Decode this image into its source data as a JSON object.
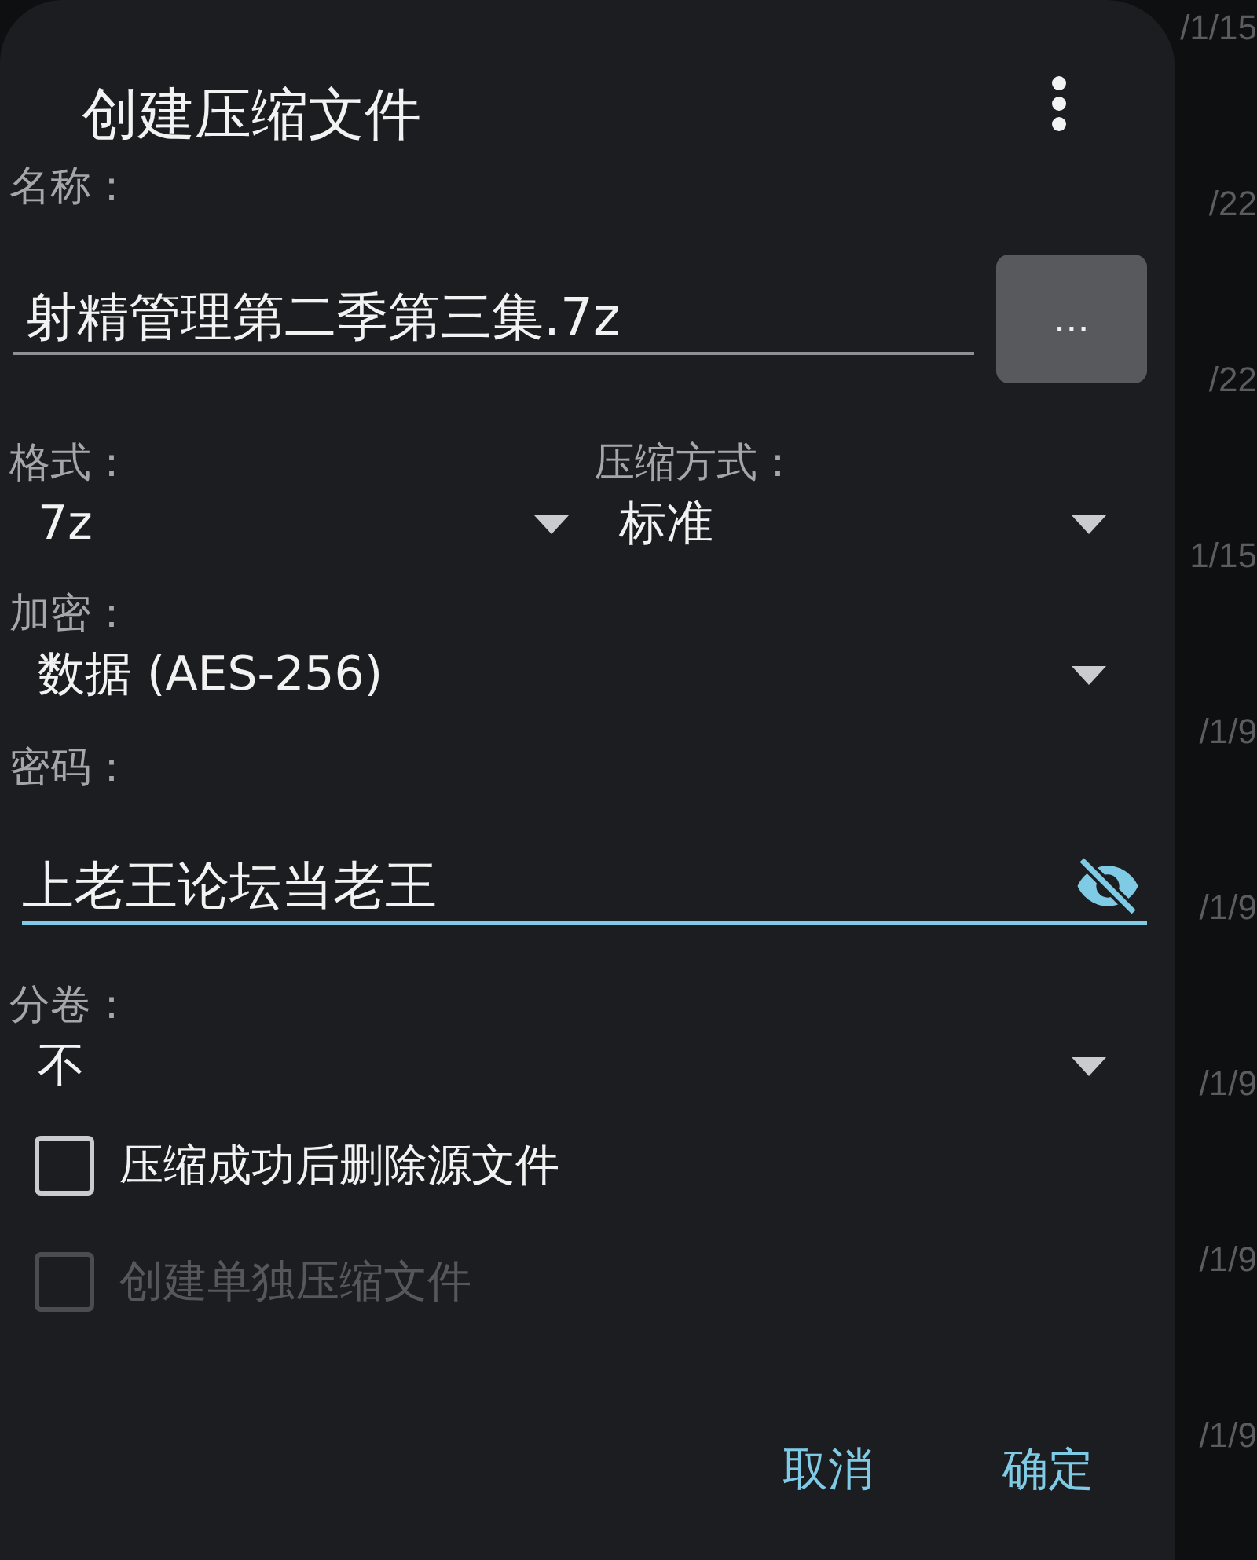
{
  "dialog": {
    "title": "创建压缩文件",
    "name": {
      "label": "名称：",
      "value": "射精管理第二季第三集.7z",
      "browse": "..."
    },
    "format": {
      "label": "格式：",
      "value": "7z"
    },
    "method": {
      "label": "压缩方式：",
      "value": "标准"
    },
    "encryption": {
      "label": "加密：",
      "value": "数据 (AES-256)"
    },
    "password": {
      "label": "密码：",
      "value": "上老王论坛当老王",
      "focused": true
    },
    "split": {
      "label": "分卷：",
      "value": "不"
    },
    "options": [
      {
        "label": "压缩成功后删除源文件",
        "checked": false,
        "disabled": false
      },
      {
        "label": "创建单独压缩文件",
        "checked": false,
        "disabled": true
      }
    ],
    "buttons": [
      {
        "label": "取消"
      },
      {
        "label": "确定"
      }
    ]
  },
  "background_dates": [
    "/1/15",
    "/22",
    "/22",
    "1/15",
    "/1/9",
    "/1/9",
    "/1/9",
    "/1/9",
    "/1/9"
  ]
}
